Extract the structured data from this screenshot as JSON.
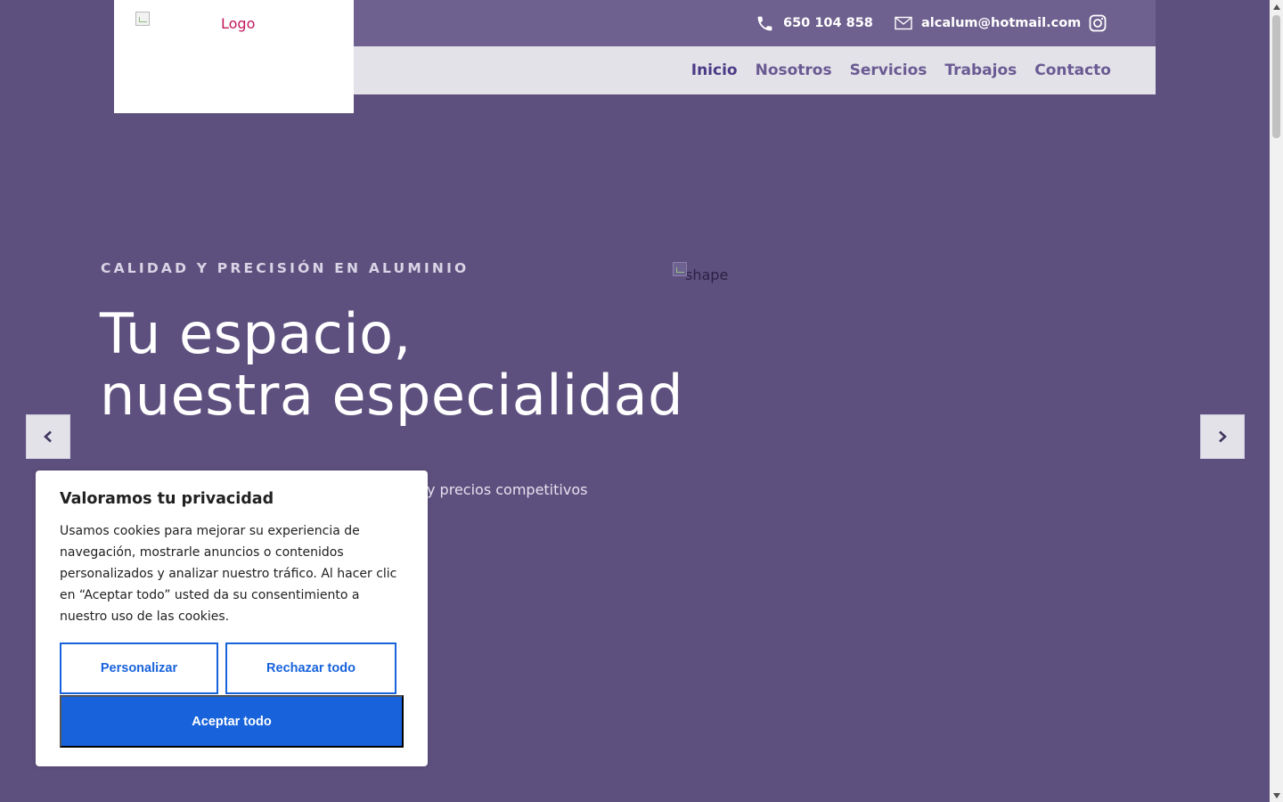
{
  "header": {
    "logo_alt": "Logo",
    "phone": "650 104 858",
    "email": "alcalum@hotmail.com",
    "icons": {
      "phone": "phone-icon",
      "email": "mail-icon",
      "social": "instagram-icon"
    }
  },
  "nav": {
    "items": [
      {
        "label": "Inicio",
        "active": true
      },
      {
        "label": "Nosotros",
        "active": false
      },
      {
        "label": "Servicios",
        "active": false
      },
      {
        "label": "Trabajos",
        "active": false
      },
      {
        "label": "Contacto",
        "active": false
      }
    ]
  },
  "hero": {
    "eyebrow": "CALIDAD Y PRECISIÓN EN ALUMINIO",
    "title_line1": "Tu espacio,",
    "title_line2": "nuestra especialidad",
    "subtitle_visible": "y precios competitivos",
    "image_alt": "shape"
  },
  "slider": {
    "prev_icon": "chevron-left-icon",
    "next_icon": "chevron-right-icon"
  },
  "cookie_banner": {
    "title": "Valoramos tu privacidad",
    "text": "Usamos cookies para mejorar su experiencia de navegación, mostrarle anuncios o contenidos personalizados y analizar nuestro tráfico. Al hacer clic en “Aceptar todo” usted da su consentimiento a nuestro uso de las cookies.",
    "customize_label": "Personalizar",
    "reject_label": "Rechazar todo",
    "accept_label": "Aceptar todo"
  },
  "colors": {
    "background": "#5e507e",
    "topbar": "#6f618f",
    "navbar": "#e3e2e8",
    "nav_text": "#6a5a93",
    "cookie_accent": "#1863dc"
  }
}
